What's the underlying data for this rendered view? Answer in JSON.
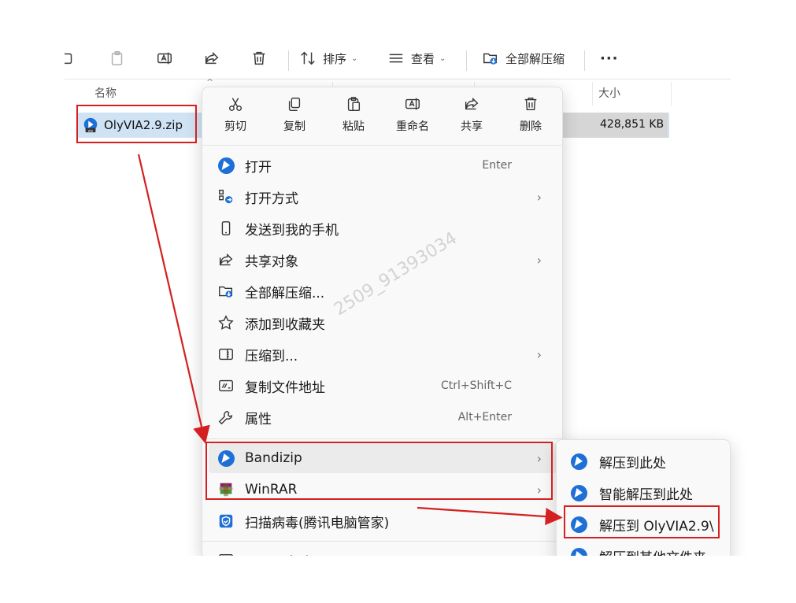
{
  "toolbar": {
    "sort_label": "排序",
    "view_label": "查看",
    "extract_all_label": "全部解压缩",
    "more_label": "···"
  },
  "columns": {
    "name": "名称",
    "size": "大小"
  },
  "file": {
    "name": "OlyVIA2.9.zip",
    "size": "428,851 KB"
  },
  "quick_actions": [
    {
      "label": "剪切",
      "icon": "scissors-icon"
    },
    {
      "label": "复制",
      "icon": "copy-icon"
    },
    {
      "label": "粘贴",
      "icon": "paste-icon"
    },
    {
      "label": "重命名",
      "icon": "rename-icon"
    },
    {
      "label": "共享",
      "icon": "share-icon"
    },
    {
      "label": "删除",
      "icon": "trash-icon"
    }
  ],
  "menu_items": [
    {
      "label": "打开",
      "shortcut": "Enter",
      "icon": "bandizip-icon"
    },
    {
      "label": "打开方式",
      "shortcut": "",
      "icon": "open-with-icon"
    },
    {
      "label": "发送到我的手机",
      "shortcut": "",
      "icon": "phone-icon"
    },
    {
      "label": "共享对象",
      "shortcut": "",
      "icon": "share-icon"
    },
    {
      "label": "全部解压缩...",
      "shortcut": "",
      "icon": "extract-folder-icon"
    },
    {
      "label": "添加到收藏夹",
      "shortcut": "",
      "icon": "star-icon"
    },
    {
      "label": "压缩到...",
      "shortcut": "",
      "icon": "compress-icon"
    },
    {
      "label": "复制文件地址",
      "shortcut": "Ctrl+Shift+C",
      "icon": "path-icon"
    },
    {
      "label": "属性",
      "shortcut": "Alt+Enter",
      "icon": "wrench-icon"
    },
    {
      "label": "Bandizip",
      "shortcut": "",
      "icon": "bandizip-icon"
    },
    {
      "label": "WinRAR",
      "shortcut": "",
      "icon": "winrar-icon"
    },
    {
      "label": "扫描病毒(腾讯电脑管家)",
      "shortcut": "",
      "icon": "shield-icon"
    },
    {
      "label": "显示更多选项",
      "shortcut": "",
      "icon": "more-options-icon"
    }
  ],
  "submenu_items": [
    {
      "label": "解压到此处"
    },
    {
      "label": "智能解压到此处"
    },
    {
      "label": "解压到 OlyVIA2.9\\"
    },
    {
      "label": "解压到其他文件夹"
    }
  ],
  "watermark": "2509_91393034",
  "colors": {
    "annotation_red": "#d42020",
    "bandizip_blue": "#1e6fd6",
    "selection_blue": "#cfe3f5"
  }
}
